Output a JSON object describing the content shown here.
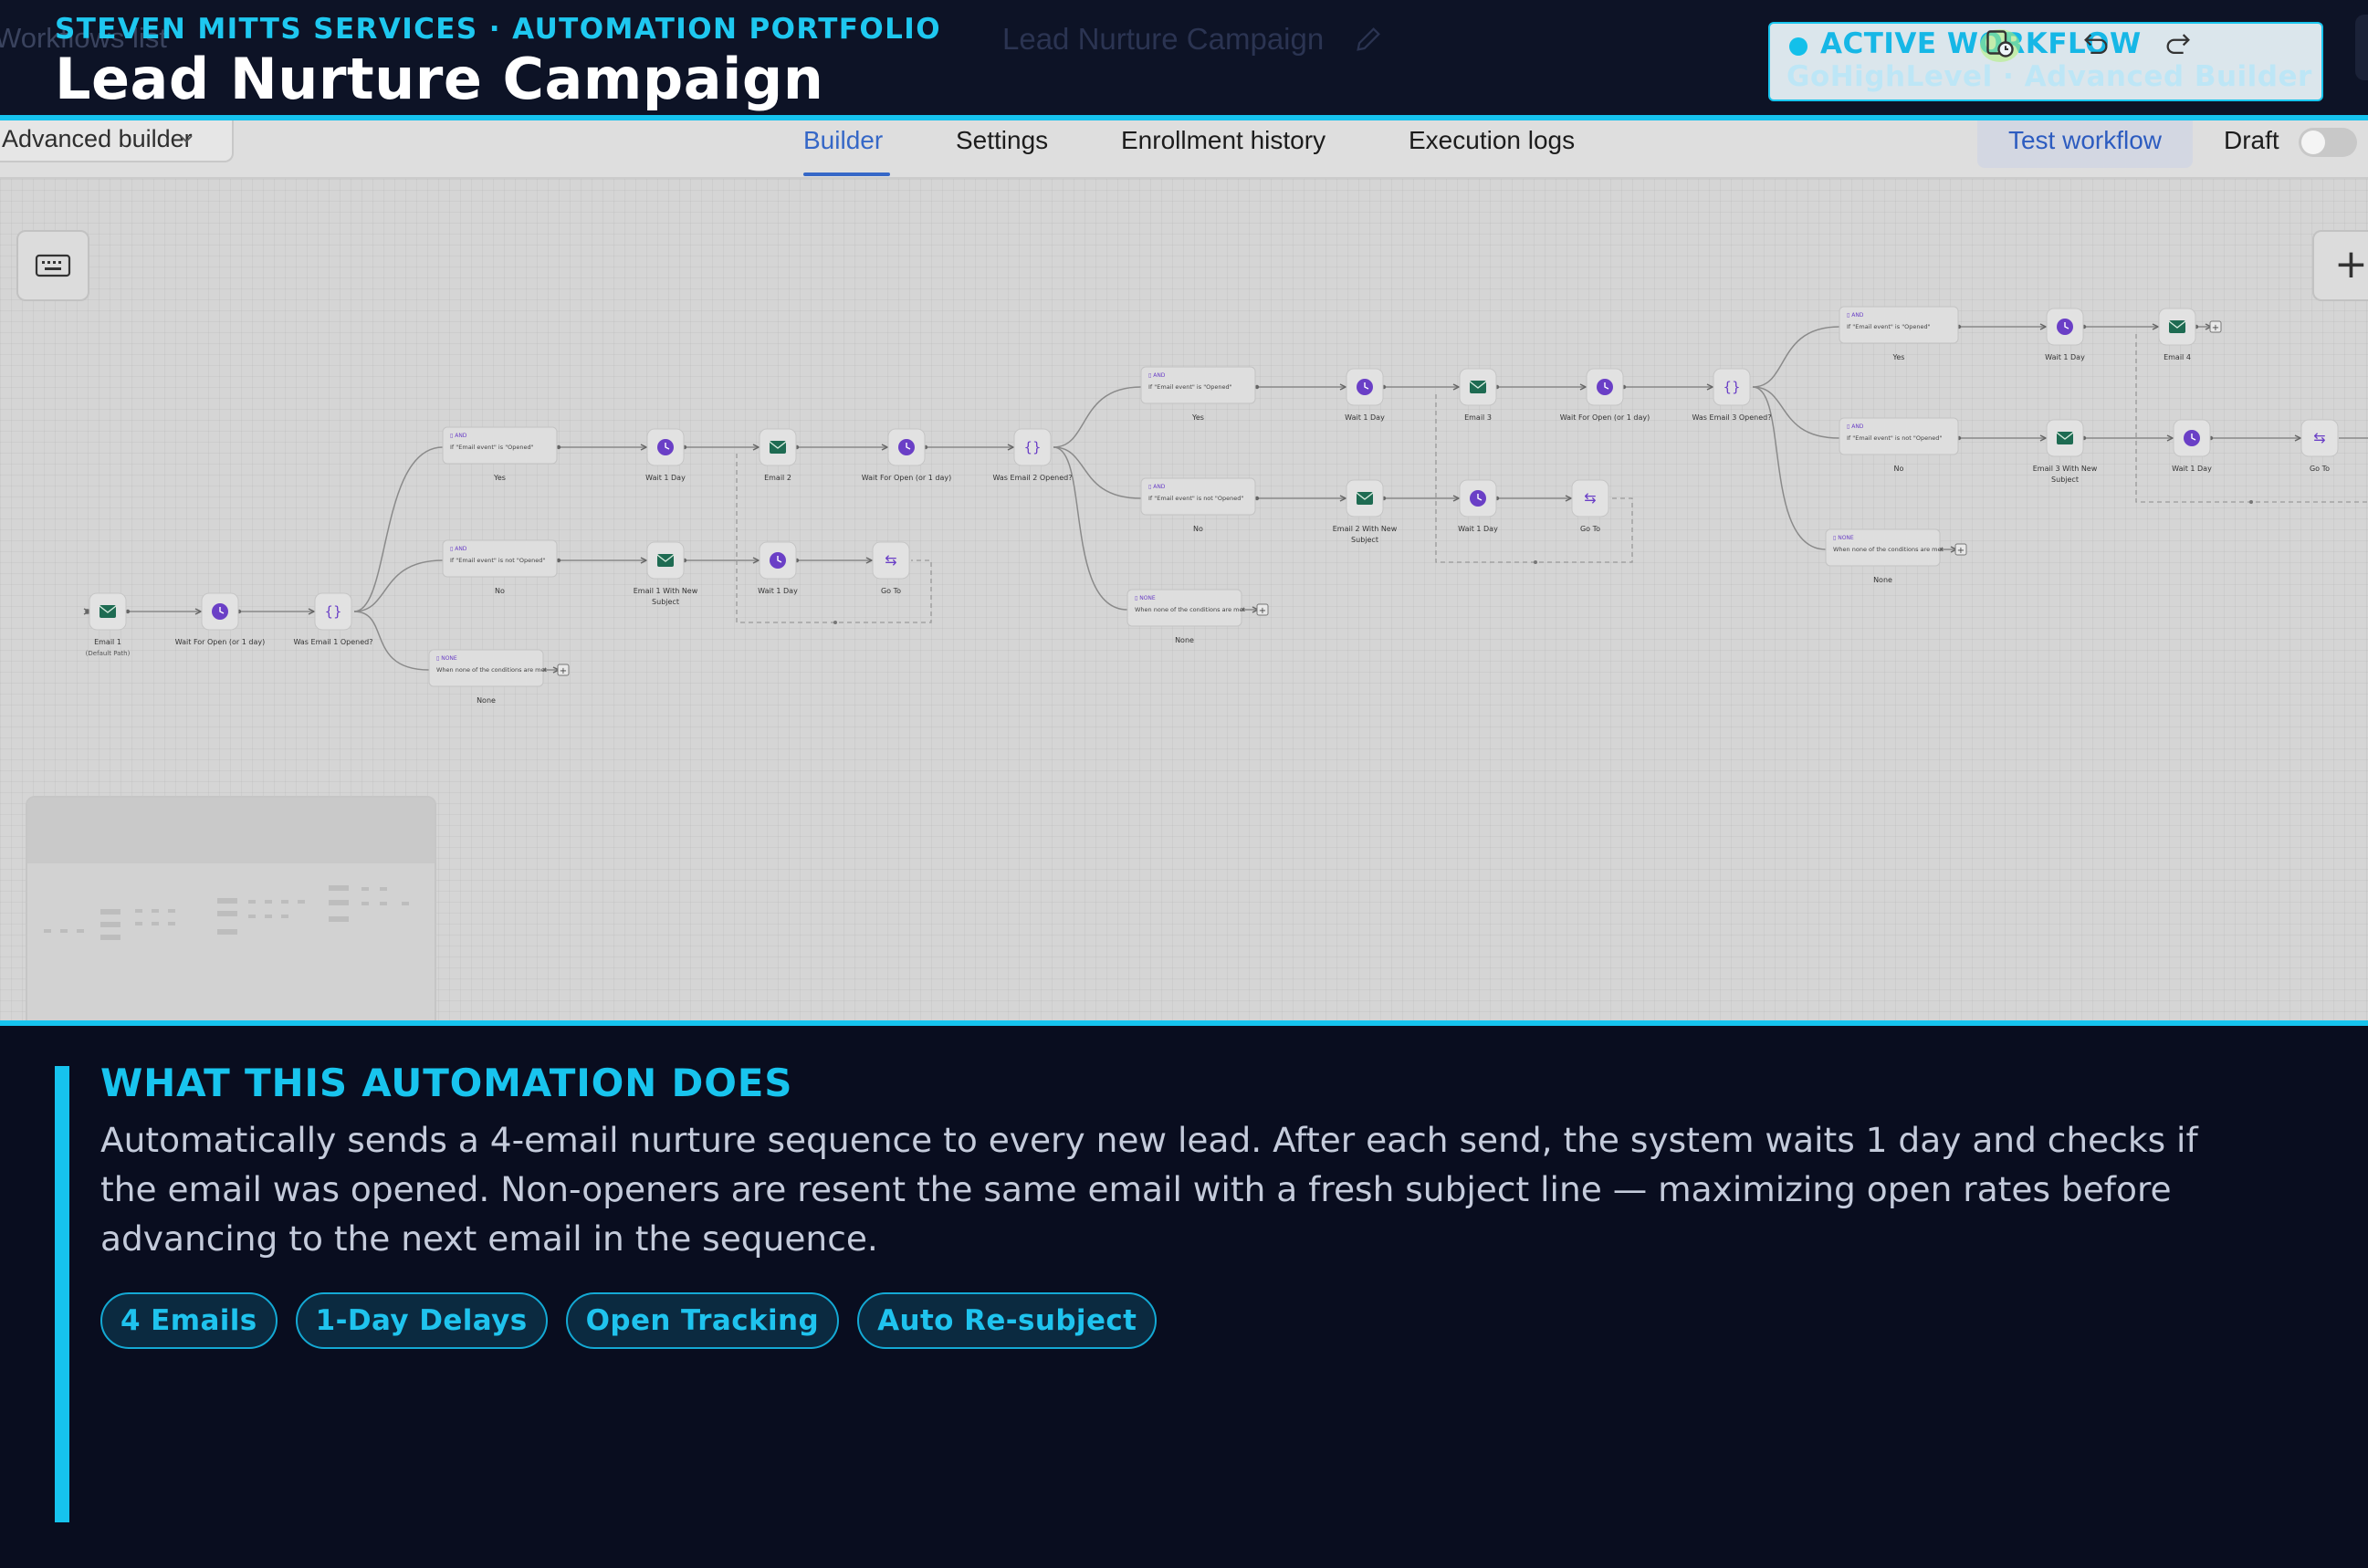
{
  "header": {
    "eyebrow": "STEVEN MITTS SERVICES  ·  AUTOMATION PORTFOLIO",
    "title": "Lead Nurture Campaign",
    "ghost_back_link": "Workflows list",
    "ghost_workflow_name": "Lead Nurture Campaign",
    "badge": {
      "label": "ACTIVE WORKFLOW",
      "platform": "GoHighLevel  ·  Advanced Builder"
    },
    "colors": {
      "accent": "#16c3ee",
      "background": "#0d1326"
    }
  },
  "toolbar": {
    "builder_select_value": "Advanced builder",
    "tabs": [
      {
        "label": "Builder",
        "active": true
      },
      {
        "label": "Settings",
        "active": false
      },
      {
        "label": "Enrollment history",
        "active": false
      },
      {
        "label": "Execution logs",
        "active": false
      }
    ],
    "test_button_label": "Test workflow",
    "draft_label": "Draft",
    "draft_enabled": false,
    "icons": [
      "chevron-down-icon",
      "save-history-icon",
      "undo-icon",
      "redo-icon"
    ]
  },
  "canvas": {
    "controls": {
      "zoom_in_label": "+",
      "icons": [
        "keyboard-icon",
        "plus-icon"
      ]
    },
    "nodes": {
      "email1": "Email 1",
      "email1_sub": "(Default Path)",
      "wait_open_1": "Wait For Open (or 1 day)",
      "opened_1": "Was Email 1 Opened?",
      "yes_1": "Yes",
      "no_1": "No",
      "none_1": "None",
      "wait_1day_a": "Wait 1 Day",
      "email2": "Email 2",
      "wait_open_2": "Wait For Open (or 1 day)",
      "opened_2": "Was Email 2 Opened?",
      "email1_new_subject": "Email 1 With New Subject",
      "wait_1day_b": "Wait 1 Day",
      "goto_1": "Go To",
      "yes_2": "Yes",
      "no_2": "No",
      "none_2": "None",
      "wait_1day_c": "Wait 1 Day",
      "email3": "Email 3",
      "wait_open_3": "Wait For Open (or 1 day)",
      "opened_3": "Was Email 3 Opened?",
      "email2_new_subject": "Email 2 With New Subject",
      "wait_1day_d": "Wait 1 Day",
      "goto_2": "Go To",
      "yes_3": "Yes",
      "no_3": "No",
      "none_3": "None",
      "wait_1day_e": "Wait 1 Day",
      "email4": "Email 4",
      "email3_new_subject": "Email 3 With New Subject",
      "wait_1day_f": "Wait 1 Day",
      "goto_3": "Go To"
    },
    "conditions": {
      "opened": "If \"Email event\" is \"Opened\"",
      "not_opened": "If \"Email event\" is not \"Opened\"",
      "none": "When none of the conditions are met",
      "and_tag": "AND",
      "none_tag": "NONE"
    },
    "colors": {
      "email": "#1e6b52",
      "wait": "#6a3fc6",
      "branch": "#6a3fc6"
    }
  },
  "panel": {
    "heading": "WHAT THIS AUTOMATION DOES",
    "description": "Automatically sends a 4-email nurture sequence to every new lead. After each send, the system waits 1 day and checks if the email was opened. Non-openers are resent the same email with a fresh subject line — maximizing open rates before advancing to the next email in the sequence.",
    "chips": [
      "4 Emails",
      "1-Day Delays",
      "Open Tracking",
      "Auto Re-subject"
    ]
  }
}
